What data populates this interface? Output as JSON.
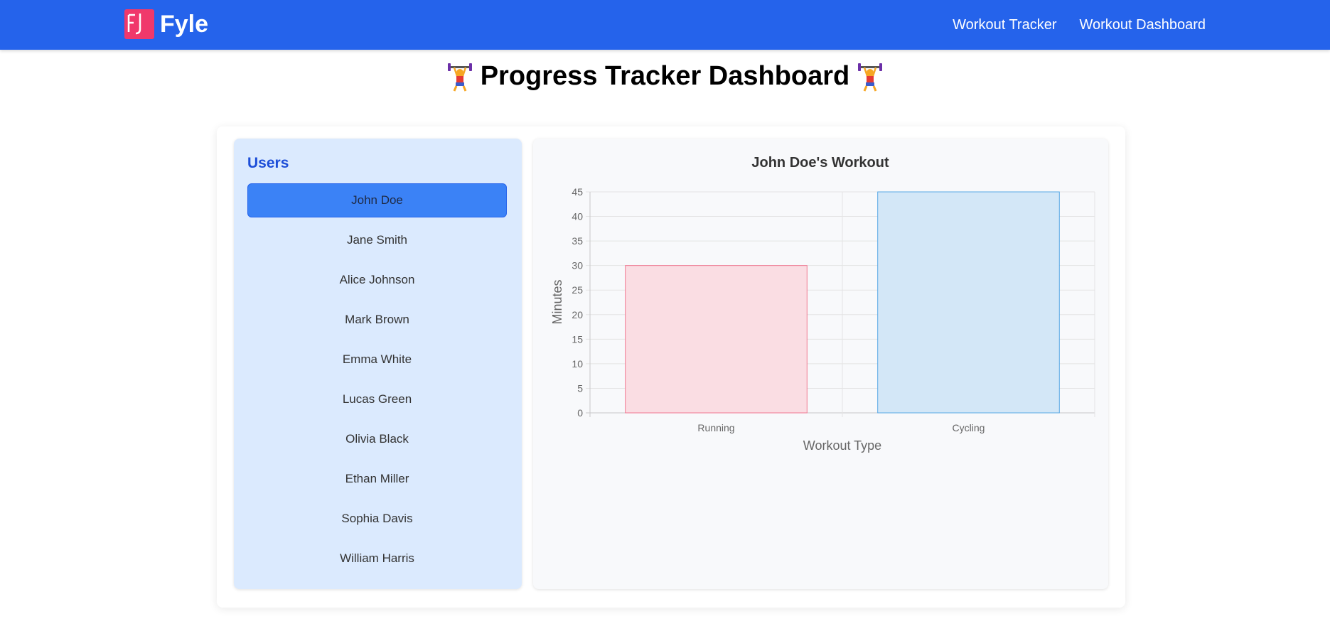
{
  "navbar": {
    "brand_name": "Fyle",
    "logo_text": "FJ",
    "links": [
      {
        "label": "Workout Tracker"
      },
      {
        "label": "Workout Dashboard"
      }
    ]
  },
  "page": {
    "title": "Progress Tracker Dashboard",
    "title_emoji": "weight-lifter-emoji"
  },
  "users": {
    "heading": "Users",
    "selected": "John Doe",
    "items": [
      {
        "name": "John Doe"
      },
      {
        "name": "Jane Smith"
      },
      {
        "name": "Alice Johnson"
      },
      {
        "name": "Mark Brown"
      },
      {
        "name": "Emma White"
      },
      {
        "name": "Lucas Green"
      },
      {
        "name": "Olivia Black"
      },
      {
        "name": "Ethan Miller"
      },
      {
        "name": "Sophia Davis"
      },
      {
        "name": "William Harris"
      }
    ]
  },
  "colors": {
    "navbar": "#2563eb",
    "logo": "#f0386b",
    "active_user": "#3b82f6",
    "users_panel": "#dbeafe",
    "running_fill": "#fadde3",
    "running_stroke": "#f07891",
    "cycling_fill": "#d3e7f7",
    "cycling_stroke": "#5aa9e6"
  },
  "chart_data": {
    "type": "bar",
    "title": "John Doe's Workout",
    "xlabel": "Workout Type",
    "ylabel": "Minutes",
    "categories": [
      "Running",
      "Cycling"
    ],
    "values": [
      30,
      45
    ],
    "ylim": [
      0,
      45
    ],
    "yticks": [
      "0",
      "5",
      "10",
      "15",
      "20",
      "25",
      "30",
      "35",
      "40",
      "45"
    ],
    "grid": true,
    "legend": "none"
  }
}
